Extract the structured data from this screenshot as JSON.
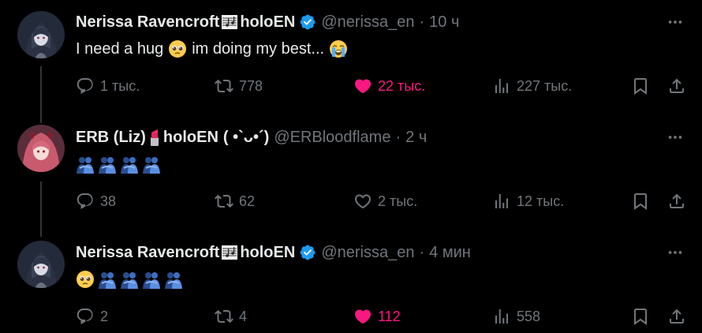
{
  "tweets": [
    {
      "name": "Nerissa Ravencroft🎼 holoEN",
      "name_main": "Nerissa Ravencroft",
      "name_suffix": "holoEN",
      "handle": "@nerissa_en",
      "dot": "·",
      "time": "10 ч",
      "text": "I need a hug",
      "text_mid": "im doing my best...",
      "replies": "1 тыс.",
      "retweets": "778",
      "likes": "22 тыс.",
      "views": "227 тыс.",
      "liked": true
    },
    {
      "name_main": "ERB (Liz)",
      "name_suffix": "holoEN",
      "kaomoji": "( •`ᴗ•´)",
      "handle": "@ERBloodflame",
      "dot": "·",
      "time": "2 ч",
      "replies": "38",
      "retweets": "62",
      "likes": "2 тыс.",
      "views": "12 тыс.",
      "liked": false
    },
    {
      "name_main": "Nerissa Ravencroft",
      "name_suffix": "holoEN",
      "handle": "@nerissa_en",
      "dot": "·",
      "time": "4 мин",
      "replies": "2",
      "retweets": "4",
      "likes": "112",
      "views": "558",
      "liked": true
    }
  ],
  "colors": {
    "background": "#000000",
    "text": "#e7e9ea",
    "muted": "#71767b",
    "like": "#f91880",
    "verified": "#1d9bf0"
  },
  "icons": {
    "reply": "reply-icon",
    "retweet": "retweet-icon",
    "like": "heart-icon",
    "views": "views-icon",
    "bookmark": "bookmark-icon",
    "share": "share-icon",
    "more": "more-icon"
  }
}
